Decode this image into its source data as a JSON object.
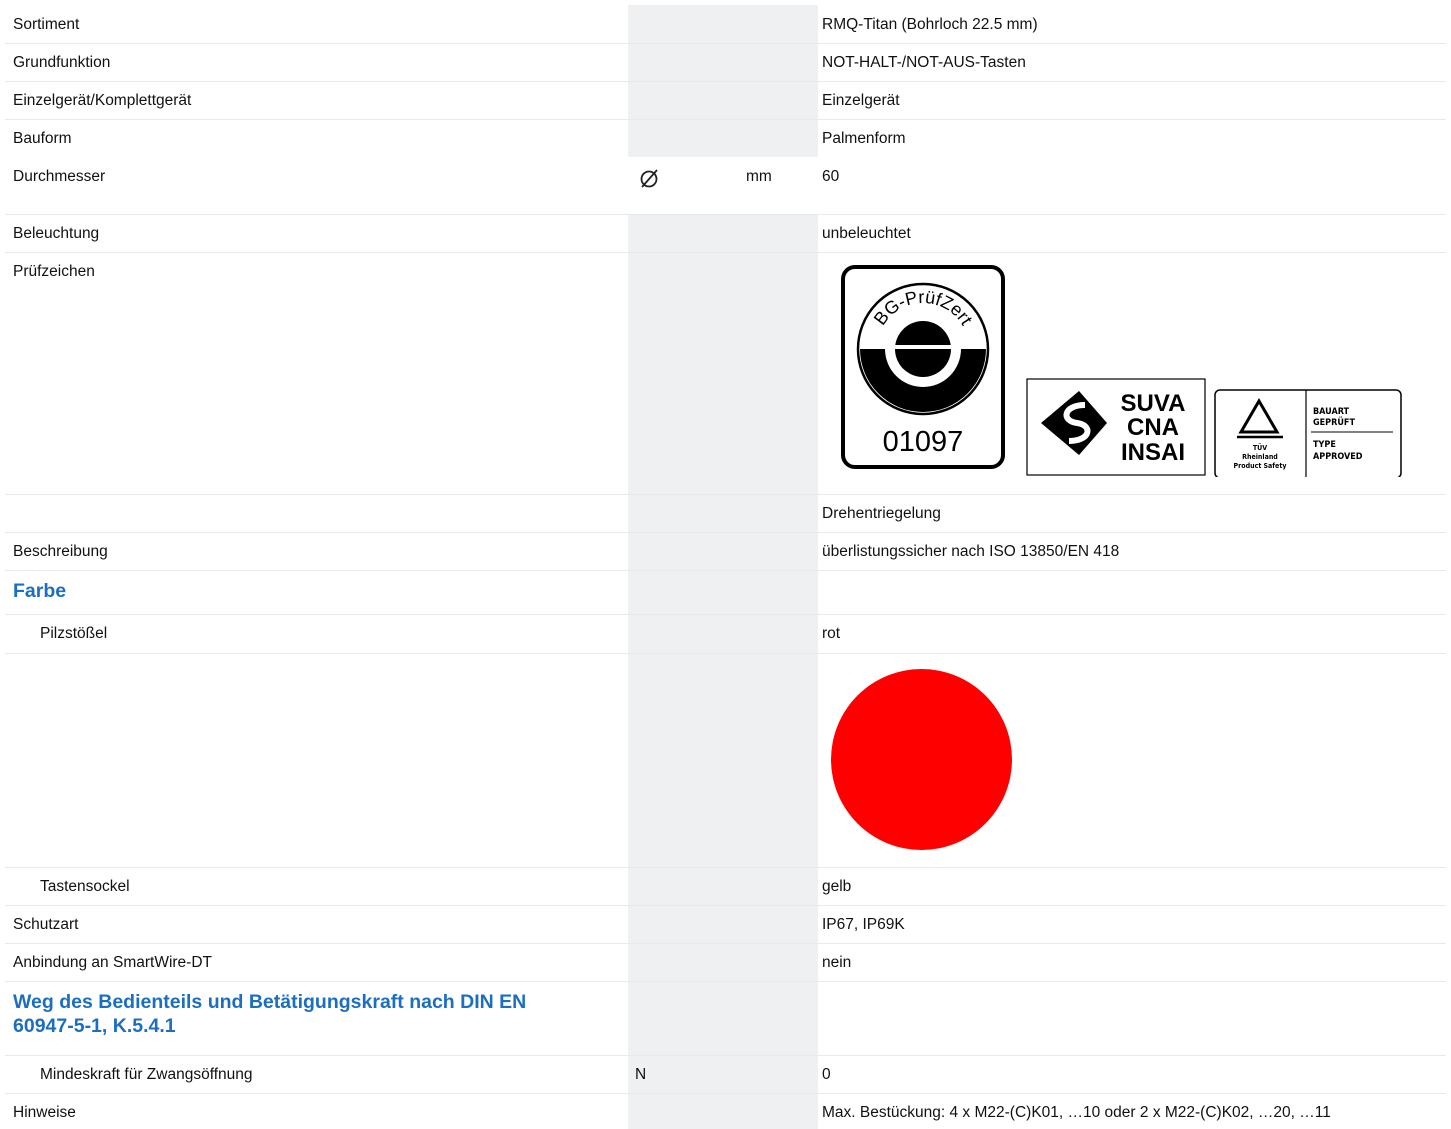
{
  "rows": [
    {
      "label": "Sortiment",
      "value": "RMQ-Titan (Bohrloch 22.5 mm)"
    },
    {
      "label": "Grundfunktion",
      "value": "NOT-HALT-/NOT-AUS-Tasten"
    },
    {
      "label": "Einzelgerät/Komplettgerät",
      "value": "Einzelgerät"
    },
    {
      "label": "Bauform",
      "value": "Palmenform"
    },
    {
      "label": "Durchmesser",
      "unit": "mm",
      "value": "60",
      "symbol_icon": "diameter-icon"
    },
    {
      "label": "Beleuchtung",
      "value": "unbeleuchtet"
    },
    {
      "label": "Prüfzeichen"
    },
    {
      "label": "",
      "value": "Drehentriegelung"
    },
    {
      "label": "Beschreibung",
      "value": "überlistungssicher nach ISO 13850/EN 418"
    },
    {
      "label": "Pilzstößel",
      "value": "rot"
    },
    {
      "label": "Tastensockel",
      "value": "gelb"
    },
    {
      "label": "Schutzart",
      "value": "IP67, IP69K"
    },
    {
      "label": "Anbindung an SmartWire-DT",
      "value": "nein"
    },
    {
      "label": "Mindeskraft für Zwangsöffnung",
      "unit": "N",
      "value": "0"
    },
    {
      "label": "Hinweise",
      "value": "Max. Bestückung: 4 x M22-(C)K01, …10 oder 2 x M22-(C)K02, …20, …11"
    }
  ],
  "sections": {
    "farbe": "Farbe",
    "weg": "Weg des Bedienteils und Betätigungskraft nach DIN EN 60947-5-1, K.5.4.1"
  },
  "certs": {
    "bg": {
      "arc_text": "BG-PrüfZert",
      "number": "01097"
    },
    "suva": {
      "lines": [
        "SUVA",
        "CNA",
        "INSAI"
      ]
    },
    "tuv": {
      "brand": [
        "TÜV",
        "Rheinland",
        "Product Safety"
      ],
      "right": [
        "BAUART",
        "GEPRÜFT",
        "TYPE",
        "APPROVED"
      ]
    }
  },
  "swatch": {
    "color": "#ff0000"
  }
}
